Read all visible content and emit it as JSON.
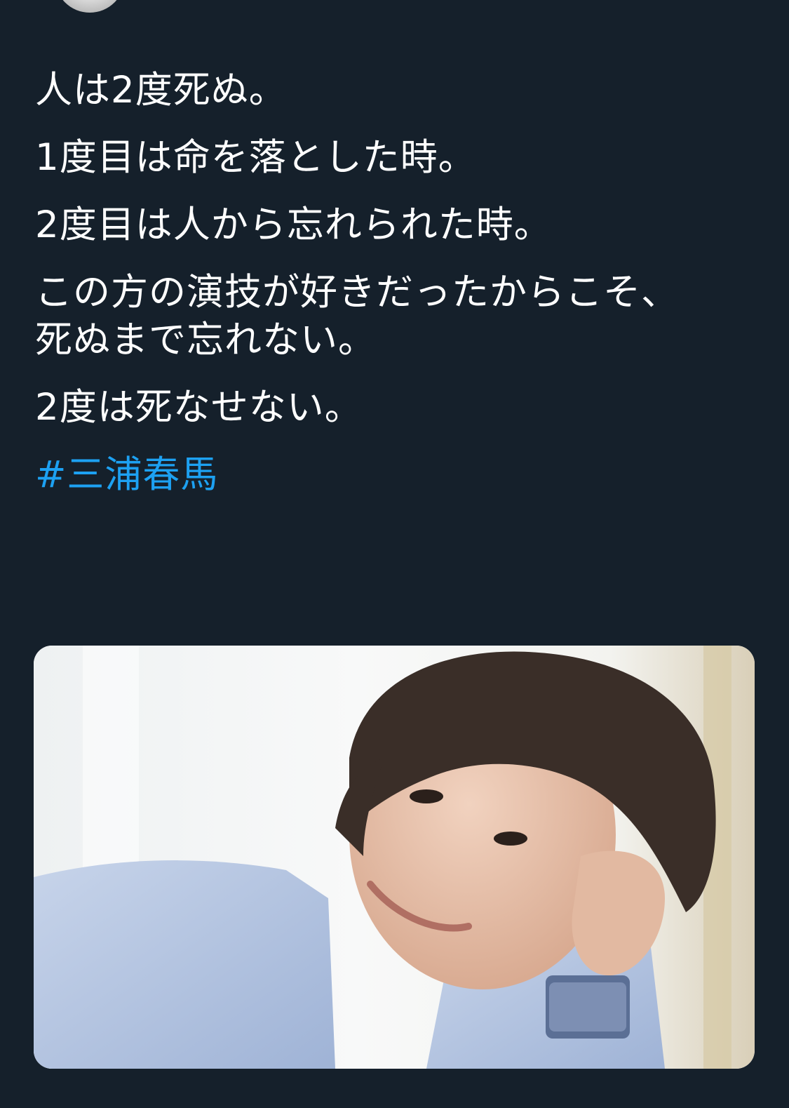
{
  "tweet": {
    "paragraphs": [
      "人は2度死ぬ。",
      "1度目は命を落とした時。",
      "2度目は人から忘れられた時。",
      "この方の演技が好きだったからこそ、死ぬまで忘れない。",
      "2度は死なせない。"
    ],
    "hashtag": "#三浦春馬"
  },
  "colors": {
    "background": "#15202b",
    "text": "#ffffff",
    "link": "#1da1f2"
  }
}
